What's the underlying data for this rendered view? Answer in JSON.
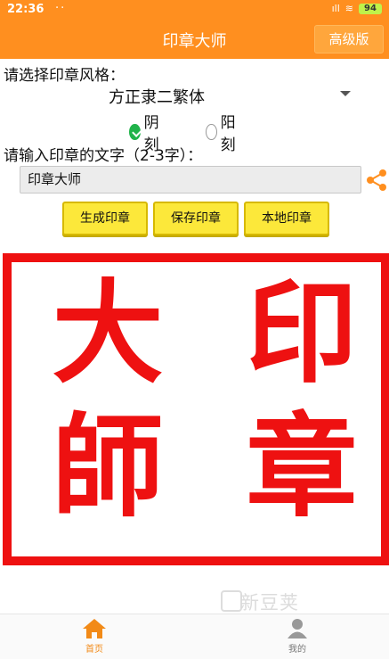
{
  "status_bar": {
    "time": "22:36",
    "dots": "··",
    "signal": "ıll",
    "wifi": "≋",
    "battery": "94"
  },
  "app_bar": {
    "title": "印章大师",
    "pro_button": "高级版"
  },
  "form": {
    "style_label": "请选择印章风格：",
    "font_value": "方正隶二繁体",
    "radio_yin": "阴刻",
    "radio_yang": "阳刻",
    "yin_checked": true,
    "text_label": "请输入印章的文字（2-3字）：",
    "text_value": "印章大师"
  },
  "buttons": {
    "generate": "生成印章",
    "save": "保存印章",
    "local": "本地印章"
  },
  "seal": {
    "char_1": "印",
    "char_2": "章",
    "char_3": "大",
    "char_4": "師",
    "color": "#ee1111"
  },
  "nav": {
    "home": "首页",
    "mine": "我的"
  },
  "watermark": "新豆荚",
  "colors": {
    "accent": "#ff8f1f",
    "button_yellow": "#fce83a",
    "check_green": "#20b34a"
  }
}
